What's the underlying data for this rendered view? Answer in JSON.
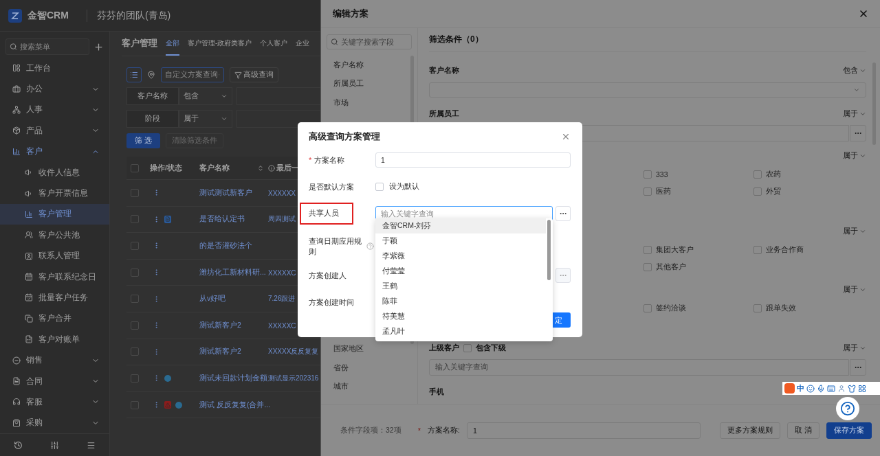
{
  "header": {
    "brand": "金智CRM",
    "team": "芬芬的团队(青岛)"
  },
  "sidebar": {
    "search_placeholder": "搜索菜单",
    "items": [
      {
        "kind": "link",
        "label": "工作台",
        "selected": false
      },
      {
        "kind": "group",
        "label": "办公",
        "selected": false,
        "expanded": false
      },
      {
        "kind": "group",
        "label": "人事",
        "selected": false,
        "expanded": false
      },
      {
        "kind": "group",
        "label": "产品",
        "selected": false,
        "expanded": false
      },
      {
        "kind": "group",
        "label": "客户",
        "selected": true,
        "expanded": true,
        "children": [
          {
            "label": "收件人信息",
            "selected": false
          },
          {
            "label": "客户开票信息",
            "selected": false
          },
          {
            "label": "客户管理",
            "selected": true
          },
          {
            "label": "客户公共池",
            "selected": false
          },
          {
            "label": "联系人管理",
            "selected": false
          },
          {
            "label": "客户联系纪念日",
            "selected": false
          },
          {
            "label": "批量客户任务",
            "selected": false
          },
          {
            "label": "客户合并",
            "selected": false
          },
          {
            "label": "客户对账单",
            "selected": false
          }
        ]
      },
      {
        "kind": "group",
        "label": "销售",
        "selected": false,
        "expanded": false
      },
      {
        "kind": "group",
        "label": "合同",
        "selected": false,
        "expanded": false
      },
      {
        "kind": "group",
        "label": "客服",
        "selected": false,
        "expanded": false
      },
      {
        "kind": "group",
        "label": "采购",
        "selected": false,
        "expanded": false
      }
    ]
  },
  "main": {
    "title": "客户管理",
    "tabs": [
      {
        "label": "全部",
        "selected": true
      },
      {
        "label": "客户管理-政府类客户",
        "selected": false
      },
      {
        "label": "个人客户",
        "selected": false
      },
      {
        "label": "企业",
        "selected": false
      }
    ],
    "scheme_placeholder": "自定义方案查询",
    "advanced_button": "高级查询",
    "filters": [
      {
        "field": "客户名称",
        "operator": "包含"
      },
      {
        "field": "阶段",
        "operator": "属于"
      }
    ],
    "filter_button": "筛 选",
    "clear_button": {
      "label": "清除筛选条件",
      "disabled": true
    },
    "table": {
      "all_checked": false,
      "columns": [
        "操作/状态",
        "客户名称",
        "最后一"
      ],
      "rows": [
        {
          "checked": false,
          "name": "测试测试新客户",
          "column_4": "XXXXXX"
        },
        {
          "checked": false,
          "status_icons": [
            {
              "kind": "file"
            }
          ],
          "name": "是否给认定书",
          "column_4": "周四测试"
        },
        {
          "checked": false,
          "name": "的是否灌砂法个"
        },
        {
          "checked": false,
          "name": "潍坊化工新材料研...",
          "column_4": "XXXXXC"
        },
        {
          "checked": false,
          "name": "从v好吧",
          "column_4": "7.26跟进"
        },
        {
          "checked": false,
          "name": "测试新客户2",
          "column_4": "XXXXXC"
        },
        {
          "checked": false,
          "name": "测试新客户2",
          "column_4": "XXXXX反反复复"
        },
        {
          "checked": false,
          "status_icons": [
            {
              "kind": "dot"
            }
          ],
          "name": "测试未回款计划金额",
          "column_4": "测试显示202316"
        },
        {
          "checked": false,
          "status_icons": [
            {
              "kind": "warning"
            },
            {
              "kind": "dot"
            }
          ],
          "name": "测试 反反复复(合并..."
        }
      ]
    }
  },
  "drawer": {
    "title": "编辑方案",
    "field_search_placeholder": "关键字搜索字段",
    "fields_top": [
      "客户名称",
      "所属员工",
      "市场"
    ],
    "fields_bottom": [
      "国家地区",
      "省份",
      "城市"
    ],
    "conditions_title": "筛选条件（0）",
    "sections": [
      {
        "kind": "select",
        "label": "客户名称",
        "operator": "包含"
      },
      {
        "kind": "picker",
        "label": "所属员工",
        "operator": "属于"
      },
      {
        "kind": "checkboxes",
        "operator": "属于",
        "options": [
          {
            "label": "333",
            "checked": false
          },
          {
            "label": "农药",
            "checked": false
          },
          {
            "label": "医药",
            "checked": false
          },
          {
            "label": "外贸",
            "checked": false
          }
        ]
      },
      {
        "kind": "checkboxes",
        "operator": "属于",
        "options": [
          {
            "label": "集团大客户",
            "checked": false
          },
          {
            "label": "业务合作商",
            "checked": false
          },
          {
            "label": "其他客户",
            "checked": false
          }
        ]
      },
      {
        "kind": "checkboxes",
        "operator": "属于",
        "options": [
          {
            "label": "签约洽谈",
            "checked": false
          },
          {
            "label": "跟单失效",
            "checked": false
          }
        ]
      },
      {
        "kind": "parent_picker",
        "label": "上级客户",
        "include_label": "包含下级",
        "include_checked": false,
        "operator": "属于",
        "placeholder": "输入关键字查询"
      },
      {
        "kind": "text",
        "label": "手机"
      }
    ],
    "footer": {
      "count": "条件字段项：32项",
      "required_mark": "*",
      "name_label": "方案名称:",
      "name_value": "1",
      "buttons": [
        {
          "kind": "plain",
          "label": "更多方案规则"
        },
        {
          "kind": "plain",
          "label": "取 消"
        },
        {
          "kind": "primary",
          "label": "保存方案"
        }
      ]
    }
  },
  "dialog": {
    "title": "高级查询方案管理",
    "fields": [
      {
        "kind": "text",
        "label": "方案名称",
        "required_mark": "*",
        "value": "1"
      },
      {
        "kind": "checkbox",
        "label": "是否默认方案",
        "option": "设为默认",
        "checked": false
      },
      {
        "kind": "people",
        "label": "共享人员",
        "placeholder": "输入关键字查询",
        "highlighted": true,
        "focused": true
      },
      {
        "kind": "rule",
        "label": "查询日期应用规则"
      },
      {
        "kind": "creator",
        "label": "方案创建人"
      },
      {
        "kind": "time",
        "label": "方案创建时间"
      }
    ],
    "confirm": "定",
    "options": [
      {
        "label": "金智CRM-刘芬",
        "selected": true
      },
      {
        "label": "于颖",
        "selected": false
      },
      {
        "label": "李紫薇",
        "selected": false
      },
      {
        "label": "付莹莹",
        "selected": false
      },
      {
        "label": "王鹤",
        "selected": false
      },
      {
        "label": "陈菲",
        "selected": false
      },
      {
        "label": "符美慧",
        "selected": false
      },
      {
        "label": "孟凡叶",
        "selected": false
      }
    ]
  },
  "ime_bar": {
    "mode": "中"
  }
}
